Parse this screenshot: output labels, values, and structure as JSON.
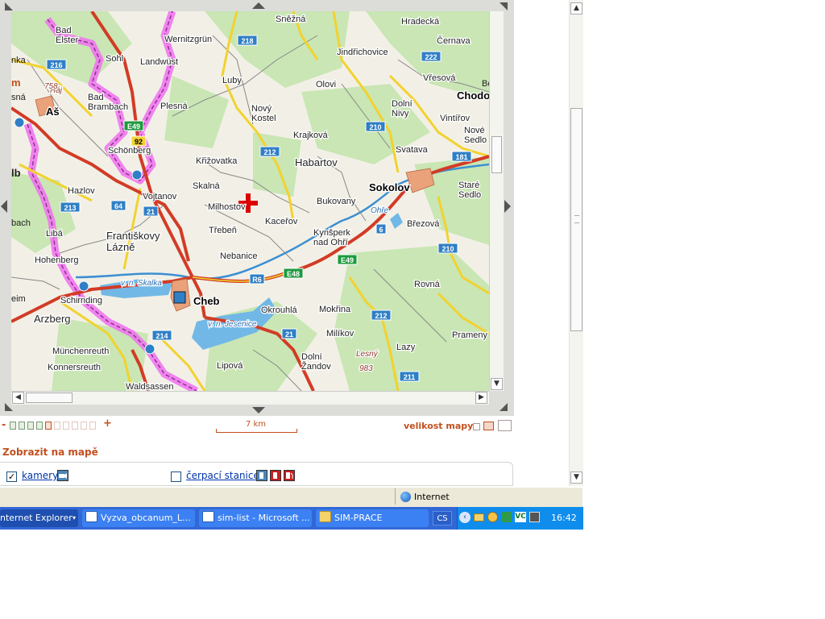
{
  "map": {
    "places": [
      {
        "name": "Bad Elster"
      },
      {
        "name": "Wernitzgrün"
      },
      {
        "name": "Sněžná"
      },
      {
        "name": "Hradecká"
      },
      {
        "name": "Sohl"
      },
      {
        "name": "Landwüst"
      },
      {
        "name": "Jindřichovice"
      },
      {
        "name": "Černava"
      },
      {
        "name": "Luby"
      },
      {
        "name": "Olovi"
      },
      {
        "name": "Vřesová"
      },
      {
        "name": "Bad Brambach"
      },
      {
        "name": "Plesná"
      },
      {
        "name": "Nový Kostel"
      },
      {
        "name": "Dolní Nivy"
      },
      {
        "name": "Chodov"
      },
      {
        "name": "Aš"
      },
      {
        "name": "Vintířov"
      },
      {
        "name": "Krajková"
      },
      {
        "name": "Nové Sedlo"
      },
      {
        "name": "Schönberg"
      },
      {
        "name": "Svatava"
      },
      {
        "name": "Křižovatka"
      },
      {
        "name": "Habartov"
      },
      {
        "name": "Skalná"
      },
      {
        "name": "Sokolov"
      },
      {
        "name": "Hazlov"
      },
      {
        "name": "Vojtanov"
      },
      {
        "name": "Bukovany"
      },
      {
        "name": "Staré Sedlo"
      },
      {
        "name": "Milhostov"
      },
      {
        "name": "Kaceřov"
      },
      {
        "name": "Libá"
      },
      {
        "name": "Františkovy Lázně"
      },
      {
        "name": "Třebeň"
      },
      {
        "name": "Kynšperk nad Ohří"
      },
      {
        "name": "Březová"
      },
      {
        "name": "Hohenberg"
      },
      {
        "name": "Nebanice"
      },
      {
        "name": "Rovná"
      },
      {
        "name": "Schirnding"
      },
      {
        "name": "Cheb"
      },
      {
        "name": "Okrouhlá"
      },
      {
        "name": "Mokřina"
      },
      {
        "name": "Arzberg"
      },
      {
        "name": "Milíkov"
      },
      {
        "name": "Prameny"
      },
      {
        "name": "Münchenreuth"
      },
      {
        "name": "Lazy"
      },
      {
        "name": "Konnersreuth"
      },
      {
        "name": "Lipová"
      },
      {
        "name": "Dolní Žandov"
      },
      {
        "name": "Waldsassen"
      },
      {
        "name": "Lesný"
      },
      {
        "name": "983"
      },
      {
        "name": "Háj"
      },
      {
        "name": "758"
      },
      {
        "name": "v. n. Skalka"
      },
      {
        "name": "v. n. Jesenice"
      },
      {
        "name": "Ohře"
      }
    ],
    "road_shields": [
      "218",
      "222",
      "216",
      "E49",
      "92",
      "210",
      "212",
      "181",
      "213",
      "64",
      "21",
      "6",
      "E49",
      "R6",
      "E48",
      "210",
      "214",
      "21",
      "212",
      "211"
    ],
    "edge_fragments": [
      "nka",
      "m",
      "sná",
      "lb",
      "bach",
      "eim",
      "Bö"
    ]
  },
  "controls": {
    "zoom_minus": "-",
    "zoom_plus": "+",
    "zoom_levels": 10,
    "zoom_selected": 4,
    "scale_label": "7 km",
    "mapsize_label": "velikost mapy:"
  },
  "show_on_map": {
    "title": "Zobrazit na mapě",
    "items": [
      {
        "label": "kamery",
        "checked": true
      },
      {
        "label": "čerpací stanice",
        "checked": false
      }
    ]
  },
  "statusbar": {
    "zone": "Internet"
  },
  "taskbar": {
    "items": [
      {
        "label": "nternet Explorer"
      },
      {
        "label": "Vyzva_obcanum_L..."
      },
      {
        "label": "sim-list - Microsoft ..."
      },
      {
        "label": "SIM-PRACE"
      }
    ],
    "lang": "CS",
    "clock": "16:42"
  },
  "colors": {
    "accent": "#c2501f",
    "link": "#0033aa",
    "road_major": "#d23b26",
    "road_secondary": "#f2d230",
    "forest": "#c9e6b4",
    "border": "#f070f0",
    "water": "#72b8e6",
    "taskbar": "#3168d5"
  }
}
